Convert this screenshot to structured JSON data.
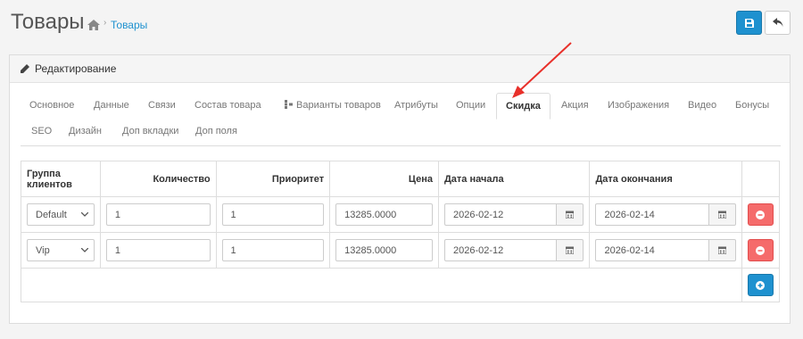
{
  "header": {
    "title": "Товары",
    "breadcrumb": {
      "separator": "›",
      "link": "Товары"
    }
  },
  "panel": {
    "heading": "Редактирование"
  },
  "tabs": [
    "Основное",
    "Данные",
    "Связи",
    "Состав товара",
    "Варианты товаров",
    "Атрибуты",
    "Опции",
    "Скидка",
    "Акция",
    "Изображения",
    "Видео",
    "Бонусы",
    "SEO",
    "Дизайн",
    "Доп вкладки",
    "Доп поля"
  ],
  "active_tab": "Скидка",
  "table": {
    "headers": {
      "group": "Группа клиентов",
      "quantity": "Количество",
      "priority": "Приоритет",
      "price": "Цена",
      "date_start": "Дата начала",
      "date_end": "Дата окончания"
    },
    "rows": [
      {
        "group": "Default",
        "quantity": "1",
        "priority": "1",
        "price": "13285.0000",
        "date_start": "2026-02-12",
        "date_end": "2026-02-14"
      },
      {
        "group": "Vip",
        "quantity": "1",
        "priority": "1",
        "price": "13285.0000",
        "date_start": "2026-02-12",
        "date_end": "2026-02-14"
      }
    ]
  },
  "icons": {
    "home": "home-icon",
    "save": "save-icon",
    "back": "reply-icon",
    "edit": "pencil-icon",
    "calendar": "calendar-icon",
    "remove": "minus-circle-icon",
    "add": "plus-circle-icon",
    "variants": "sitemap-icon"
  },
  "colors": {
    "primary": "#1e91cf",
    "danger": "#f56b6b",
    "arrow": "#e8302a"
  }
}
